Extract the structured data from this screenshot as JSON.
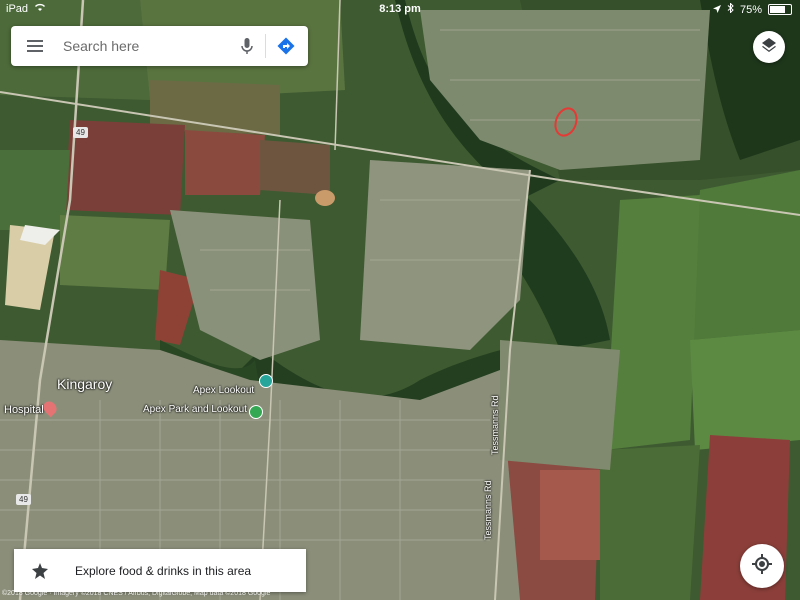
{
  "status": {
    "device": "iPad",
    "time": "8:13 pm",
    "battery": "75%",
    "battery_level": 0.75
  },
  "search": {
    "placeholder": "Search here",
    "icons": [
      "menu-icon",
      "mic-icon",
      "directions-icon"
    ]
  },
  "layers_icon": "layers-icon",
  "map_labels": {
    "town": "Kingaroy",
    "hospital": "Hospital",
    "lookout": "Apex Lookout",
    "park": "Apex Park and Lookout",
    "road_1": "Tessmanns Rd",
    "road_2": "Tessmanns Rd",
    "highway_north": "49",
    "highway_south": "49"
  },
  "explore": {
    "label": "Explore food & drinks in this area",
    "icon": "explore-food-icon"
  },
  "locate_icon": "my-location-icon",
  "copyright": "©2018 Google · Imagery ©2018 CNES / Airbus, DigitalGlobe, Map data ©2018 Google",
  "colors": {
    "accent_blue": "#1a73e8",
    "marker_teal": "#26a69a",
    "marker_green": "#34a853",
    "marker_red": "#e57373",
    "highlight_red": "#e53935"
  }
}
